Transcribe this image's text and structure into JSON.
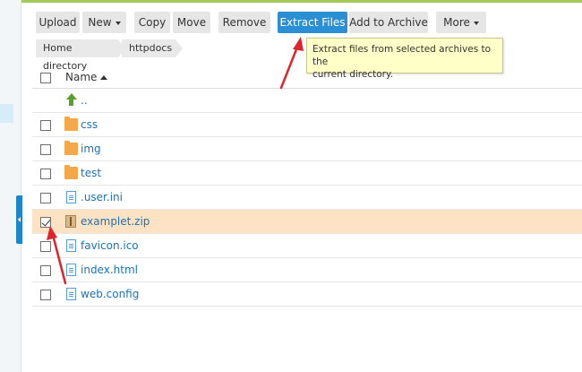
{
  "toolbar": {
    "upload": "Upload",
    "new": "New",
    "copy": "Copy",
    "move": "Move",
    "remove": "Remove",
    "extract_files": "Extract Files",
    "add_to_archive": "Add to Archive",
    "more": "More"
  },
  "breadcrumb": [
    "Home directory",
    "httpdocs"
  ],
  "tooltip": {
    "line1": "Extract files from selected archives to the",
    "line2": "current directory."
  },
  "table": {
    "column_name": "Name",
    "sort": "ascending",
    "rows": [
      {
        "name": "..",
        "icon": "up-arrow-icon",
        "checkbox": false,
        "checked": false
      },
      {
        "name": "css",
        "icon": "folder-icon",
        "checkbox": true,
        "checked": false
      },
      {
        "name": "img",
        "icon": "folder-icon",
        "checkbox": true,
        "checked": false
      },
      {
        "name": "test",
        "icon": "folder-icon",
        "checkbox": true,
        "checked": false
      },
      {
        "name": ".user.ini",
        "icon": "file-icon",
        "checkbox": true,
        "checked": false
      },
      {
        "name": "examplet.zip",
        "icon": "zip-icon",
        "checkbox": true,
        "checked": true
      },
      {
        "name": "favicon.ico",
        "icon": "image-file-icon",
        "checkbox": true,
        "checked": false
      },
      {
        "name": "index.html",
        "icon": "html-file-icon",
        "checkbox": true,
        "checked": false
      },
      {
        "name": "web.config",
        "icon": "file-icon",
        "checkbox": true,
        "checked": false
      }
    ]
  },
  "colors": {
    "accent": "#2b8fd3",
    "selected_row": "#fde2c4",
    "tooltip_bg": "#ffffc8",
    "annotation_arrow": "#e0242b",
    "link": "#1a73b8"
  }
}
